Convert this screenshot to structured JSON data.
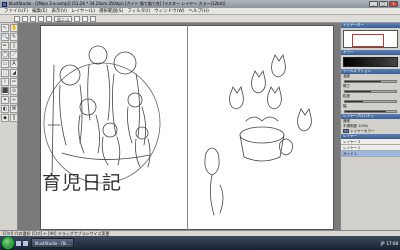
{
  "window": {
    "title": "IllustStudio - [[Mojo 3-a.ssmp]] (51.26 * 34.24cm 350dpi) [ガイド 描て描て合] [ラスター レイヤー カラー(32bit)]",
    "min_label": "_",
    "max_label": "□",
    "close_label": "x"
  },
  "menubar": {
    "items": [
      "ファイル(F)",
      "編集(E)",
      "表示(V)",
      "レイヤー(L)",
      "選択範囲(S)",
      "フィルタ(I)",
      "ウィンドウ(W)",
      "ヘルプ(H)"
    ]
  },
  "commandbar": {
    "brush_label": "鉛ニコ"
  },
  "toolbar": {
    "tools": [
      "↖",
      "✋",
      "🔍",
      "✎",
      "✏",
      "▯",
      "◯",
      "⟋",
      "▭",
      "A",
      "⬚",
      "◢",
      "⌇",
      "✂",
      "⬛",
      "⊙",
      "✦",
      "≈",
      "◐",
      "⌘",
      "◆",
      "∥"
    ]
  },
  "canvas": {
    "title_text": "育児日記"
  },
  "right_panel": {
    "navigator_title": "ナビゲーター",
    "color_title": "カラー",
    "sliders_title": "ツールオプション",
    "sliders": [
      {
        "label": "濃度",
        "value": 0.7
      },
      {
        "label": "硬さ",
        "value": 0.5
      },
      {
        "label": "粒度",
        "value": 0.35
      },
      {
        "label": "幅",
        "value": 0.8
      }
    ],
    "props_title": "レイヤープロパティ",
    "props": [
      "通常",
      "不透明度 100%",
      "レイヤーカラー"
    ],
    "layers_title": "レイヤー",
    "layers": [
      {
        "label": "レイヤー 3",
        "selected": false
      },
      {
        "label": "レイヤー 2",
        "selected": false
      },
      {
        "label": "ガイド 1",
        "selected": true
      }
    ]
  },
  "statusbar": {
    "text": "[Ctrl] 穴の選択 [Ctrl] + [Alt] ドラッグでブラシサイズ変更"
  },
  "taskbar": {
    "task_label": "IllustStudio - [Ik...",
    "tray_lang": "JP",
    "tray_time": "17:08"
  },
  "colors": {
    "titlebar": "#9aa1aa",
    "page": "#ffffff",
    "panel_header": "#4a6fa5",
    "taskbar": "#24304a"
  }
}
